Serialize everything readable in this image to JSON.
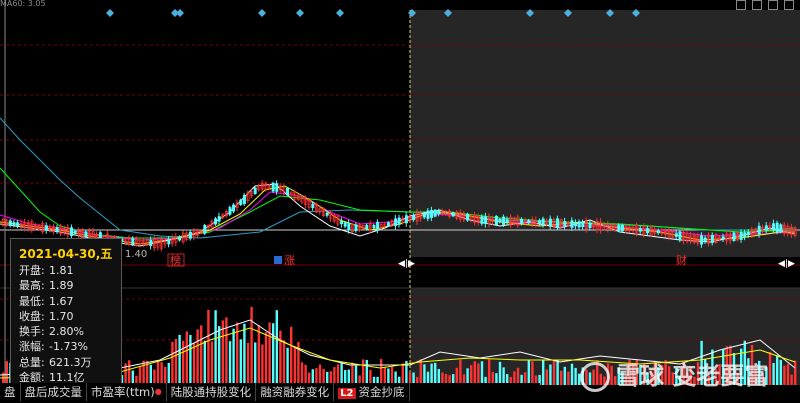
{
  "header": {
    "ma_readout": "MA60: 3.05"
  },
  "tooltip": {
    "date": "2021-04-30,五",
    "rows": [
      {
        "k": "开盘:",
        "v": "1.81"
      },
      {
        "k": "最高:",
        "v": "1.89"
      },
      {
        "k": "最低:",
        "v": "1.67"
      },
      {
        "k": "收盘:",
        "v": "1.70"
      },
      {
        "k": "换手:",
        "v": "2.80%"
      },
      {
        "k": "涨幅:",
        "v": "-1.73%"
      },
      {
        "k": "总量:",
        "v": "621.3万"
      },
      {
        "k": "金额:",
        "v": "11.1亿"
      }
    ]
  },
  "price_label": "1.40",
  "markers": {
    "bang": "榜",
    "zhang": "涨",
    "cai": "财"
  },
  "tabs": [
    {
      "label": "盘"
    },
    {
      "label": "盘后成交量"
    },
    {
      "label": "市盈率(ttm)",
      "dot": "●"
    },
    {
      "label": "陆股通持股变化"
    },
    {
      "label": "融资融券变化"
    },
    {
      "label": "资金抄底",
      "badge": "L2"
    }
  ],
  "watermark": "雪球 变老要富",
  "colors": {
    "up": "#ff3232",
    "down": "#54ffff",
    "ma5": "#ffffff",
    "ma10": "#ffff00",
    "ma20": "#ff00ff",
    "ma30": "#00ff00",
    "ma60": "#2aa0c8",
    "grid": "#7a0000",
    "dim": "#262626"
  },
  "chart_data": {
    "type": "candlestick",
    "candles_up_ratio": 0.55,
    "price_axis_note": "1.40",
    "volume_type": "bar"
  }
}
